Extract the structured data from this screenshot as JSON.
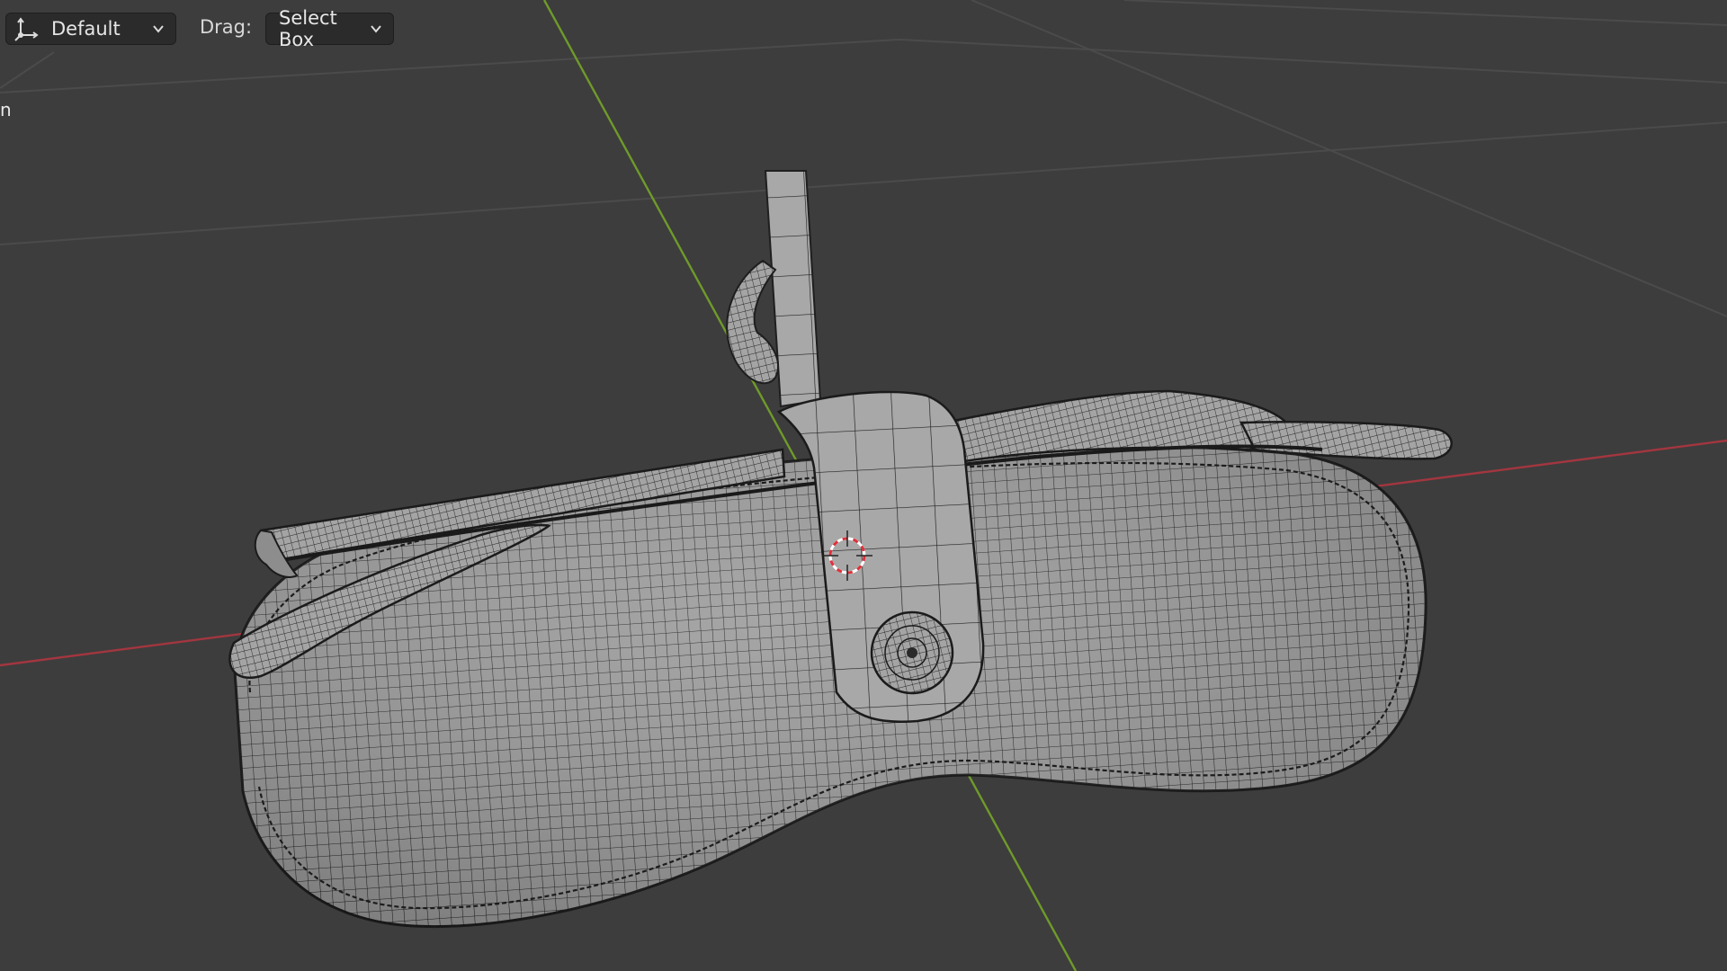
{
  "header": {
    "orientation_label": "Default",
    "drag_label": "Drag:",
    "select_mode_label": "Select Box"
  },
  "overlay": {
    "corner_text": "n"
  },
  "icons": {
    "orientation": "transform-orientation-icon",
    "dropdown": "chevron-down-icon",
    "cursor": "3d-cursor-icon"
  },
  "colors": {
    "background": "#3d3d3d",
    "grid_line": "#4a4a4a",
    "x_axis": "#a3363f",
    "y_axis": "#6f9a2a",
    "mesh_fill": "#9e9e9e",
    "wire": "#1e1e1e",
    "cursor_red": "#e0303a",
    "cursor_white": "#ffffff"
  }
}
